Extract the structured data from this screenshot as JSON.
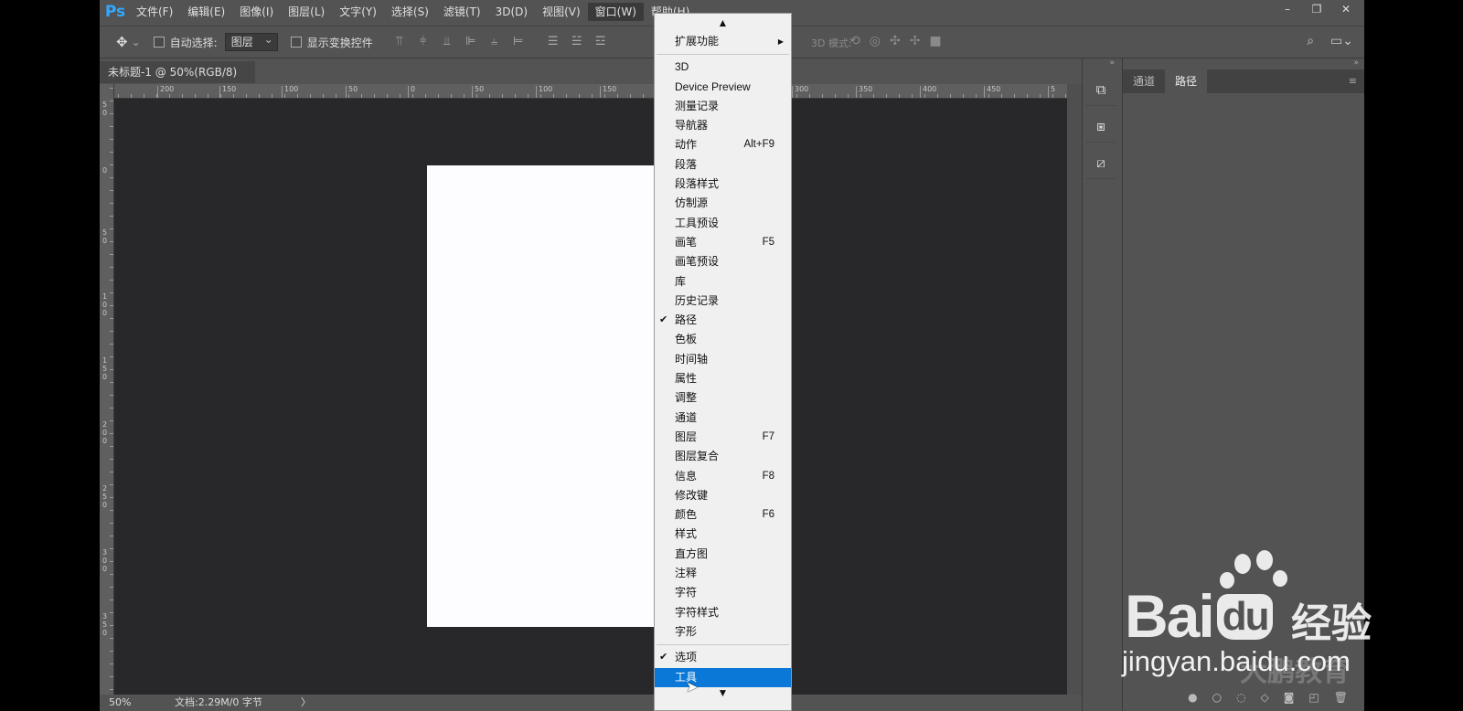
{
  "app": {
    "logo": "Ps",
    "menus": [
      "文件(F)",
      "编辑(E)",
      "图像(I)",
      "图层(L)",
      "文字(Y)",
      "选择(S)",
      "滤镜(T)",
      "3D(D)",
      "视图(V)",
      "窗口(W)",
      "帮助(H)"
    ],
    "active_menu": "窗口(W)",
    "window_controls": [
      "–",
      "❐",
      "✕"
    ]
  },
  "options_bar": {
    "auto_select_label": "自动选择:",
    "auto_select_value": "图层",
    "show_transform_label": "显示变换控件",
    "mode_3d_label": "3D 模式:"
  },
  "document": {
    "tab_title": "未标题-1 @ 50%(RGB/8)",
    "tab_close": "×",
    "zoom": "50%",
    "doc_info": "文档:2.29M/0 字节",
    "status_arrow": "〉"
  },
  "rulers": {
    "h_labels": [
      "200",
      "150",
      "100",
      "50",
      "0",
      "50",
      "100",
      "150",
      "300",
      "350",
      "400",
      "450",
      "5"
    ],
    "v_labels": [
      "5\n0",
      "0",
      "5\n0",
      "1\n0\n0",
      "1\n5\n0",
      "2\n0\n0",
      "2\n5\n0",
      "3\n0\n0",
      "3\n5\n0"
    ]
  },
  "panels": {
    "tabs": [
      "通道",
      "路径"
    ],
    "active_tab": "路径",
    "collapse_glyph": "»",
    "menu_glyph": "≡"
  },
  "window_menu": {
    "items": [
      {
        "label": "扩展功能",
        "shortcut": "",
        "checked": false,
        "submenu": true
      },
      {
        "sep": true
      },
      {
        "label": "3D",
        "shortcut": "",
        "checked": false
      },
      {
        "label": "Device Preview",
        "shortcut": "",
        "checked": false
      },
      {
        "label": "测量记录",
        "shortcut": "",
        "checked": false
      },
      {
        "label": "导航器",
        "shortcut": "",
        "checked": false
      },
      {
        "label": "动作",
        "shortcut": "Alt+F9",
        "checked": false
      },
      {
        "label": "段落",
        "shortcut": "",
        "checked": false
      },
      {
        "label": "段落样式",
        "shortcut": "",
        "checked": false
      },
      {
        "label": "仿制源",
        "shortcut": "",
        "checked": false
      },
      {
        "label": "工具预设",
        "shortcut": "",
        "checked": false
      },
      {
        "label": "画笔",
        "shortcut": "F5",
        "checked": false
      },
      {
        "label": "画笔预设",
        "shortcut": "",
        "checked": false
      },
      {
        "label": "库",
        "shortcut": "",
        "checked": false
      },
      {
        "label": "历史记录",
        "shortcut": "",
        "checked": false
      },
      {
        "label": "路径",
        "shortcut": "",
        "checked": true
      },
      {
        "label": "色板",
        "shortcut": "",
        "checked": false
      },
      {
        "label": "时间轴",
        "shortcut": "",
        "checked": false
      },
      {
        "label": "属性",
        "shortcut": "",
        "checked": false
      },
      {
        "label": "调整",
        "shortcut": "",
        "checked": false
      },
      {
        "label": "通道",
        "shortcut": "",
        "checked": false
      },
      {
        "label": "图层",
        "shortcut": "F7",
        "checked": false
      },
      {
        "label": "图层复合",
        "shortcut": "",
        "checked": false
      },
      {
        "label": "信息",
        "shortcut": "F8",
        "checked": false
      },
      {
        "label": "修改键",
        "shortcut": "",
        "checked": false
      },
      {
        "label": "颜色",
        "shortcut": "F6",
        "checked": false
      },
      {
        "label": "样式",
        "shortcut": "",
        "checked": false
      },
      {
        "label": "直方图",
        "shortcut": "",
        "checked": false
      },
      {
        "label": "注释",
        "shortcut": "",
        "checked": false
      },
      {
        "label": "字符",
        "shortcut": "",
        "checked": false
      },
      {
        "label": "字符样式",
        "shortcut": "",
        "checked": false
      },
      {
        "label": "字形",
        "shortcut": "",
        "checked": false
      },
      {
        "sep": true
      },
      {
        "label": "选项",
        "shortcut": "",
        "checked": true
      },
      {
        "label": "工具",
        "shortcut": "",
        "checked": false,
        "highlighted": true
      }
    ],
    "scroll_up": "▲",
    "scroll_down": "▼",
    "check_glyph": "✔",
    "submenu_glyph": "▶"
  },
  "watermark": {
    "brand": "Bai",
    "brand2": "du",
    "cn": "经验",
    "url": "jingyan.baidu.com",
    "sub": "大鹏教育"
  }
}
